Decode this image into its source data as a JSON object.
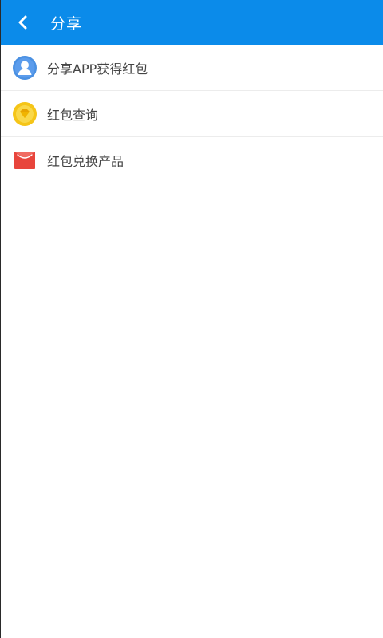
{
  "header": {
    "title": "分享",
    "back_icon": "chevron-left-icon"
  },
  "menu": {
    "items": [
      {
        "label": "分享APP获得红包",
        "icon": "user-avatar-icon",
        "color": "#4a90e2"
      },
      {
        "label": "红包查询",
        "icon": "diamond-coin-icon",
        "color": "#f5c518"
      },
      {
        "label": "红包兑换产品",
        "icon": "red-envelope-icon",
        "color": "#e8453c"
      }
    ]
  },
  "colors": {
    "app_bar": "#0b8bea",
    "divider": "#ececec",
    "text": "#444444"
  }
}
